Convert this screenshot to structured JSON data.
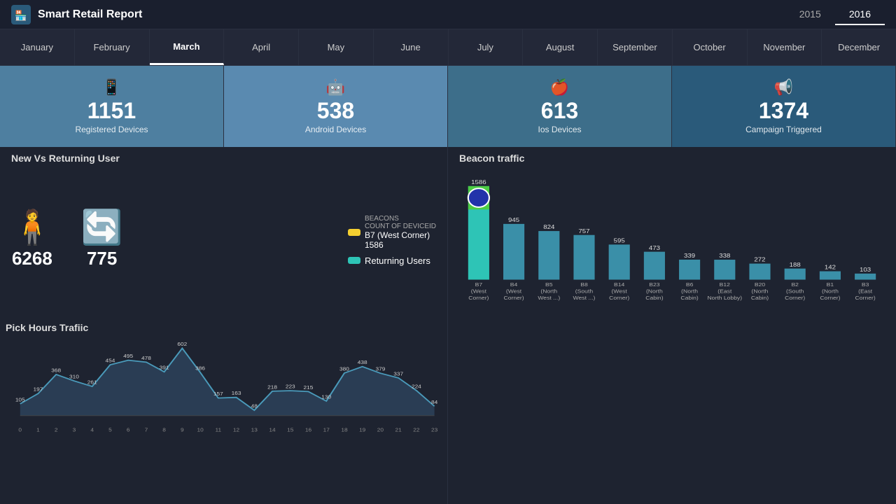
{
  "header": {
    "title": "Smart Retail Report",
    "years": [
      "2015",
      "2016"
    ],
    "active_year": "2016"
  },
  "months": [
    "January",
    "February",
    "March",
    "April",
    "May",
    "June",
    "July",
    "August",
    "September",
    "October",
    "November",
    "December"
  ],
  "active_month": "March",
  "stats": [
    {
      "icon": "📱",
      "value": "1151",
      "label": "Registered Devices"
    },
    {
      "icon": "🤖",
      "value": "538",
      "label": "Android Devices"
    },
    {
      "icon": "🍎",
      "value": "613",
      "label": "Ios Devices"
    },
    {
      "icon": "📢",
      "value": "1374",
      "label": "Campaign Triggered"
    }
  ],
  "new_vs_returning": {
    "title": "New Vs Returning User",
    "new_count": "6268",
    "returning_count": "775",
    "legend": {
      "beacons_label": "BEACONS",
      "beacons_sub": "COUNT OF DEVICEID",
      "beacons_value": "B7 (West Corner)",
      "beacons_count": "1586",
      "returning_label": "Returning Users"
    }
  },
  "beacon_traffic": {
    "title": "Beacon traffic",
    "bars": [
      {
        "label": "B7\n(West\nCorner)",
        "value": 1586
      },
      {
        "label": "B4\n(West\nCorner)",
        "value": 945
      },
      {
        "label": "B5\n(North\nWest ...)",
        "value": 824
      },
      {
        "label": "B8\n(South\nWest ...)",
        "value": 757
      },
      {
        "label": "B14\n(West\nCorner)",
        "value": 595
      },
      {
        "label": "B23\n(North\nCabin)",
        "value": 473
      },
      {
        "label": "B6\n(North\nCabin)",
        "value": 339
      },
      {
        "label": "B12\n(East\nNorth Lobby)",
        "value": 338
      },
      {
        "label": "B20\n(North\nCabin)",
        "value": 272
      },
      {
        "label": "B2\n(South\nCorner)",
        "value": 188
      },
      {
        "label": "B1\n(North\nCorner)",
        "value": 142
      },
      {
        "label": "B3\n(East\nCorner)",
        "value": 103
      }
    ]
  },
  "pick_hours": {
    "title": "Pick Hours Trafiic",
    "data": [
      105,
      197,
      368,
      310,
      261,
      454,
      495,
      478,
      391,
      602,
      386,
      157,
      163,
      48,
      218,
      223,
      215,
      130,
      380,
      438,
      379,
      337,
      224,
      84
    ],
    "labels": [
      "0",
      "1",
      "2",
      "3",
      "4",
      "5",
      "6",
      "7",
      "8",
      "9",
      "10",
      "11",
      "12",
      "13",
      "14",
      "15",
      "16",
      "17",
      "18",
      "19",
      "20",
      "21",
      "22",
      "23"
    ]
  }
}
